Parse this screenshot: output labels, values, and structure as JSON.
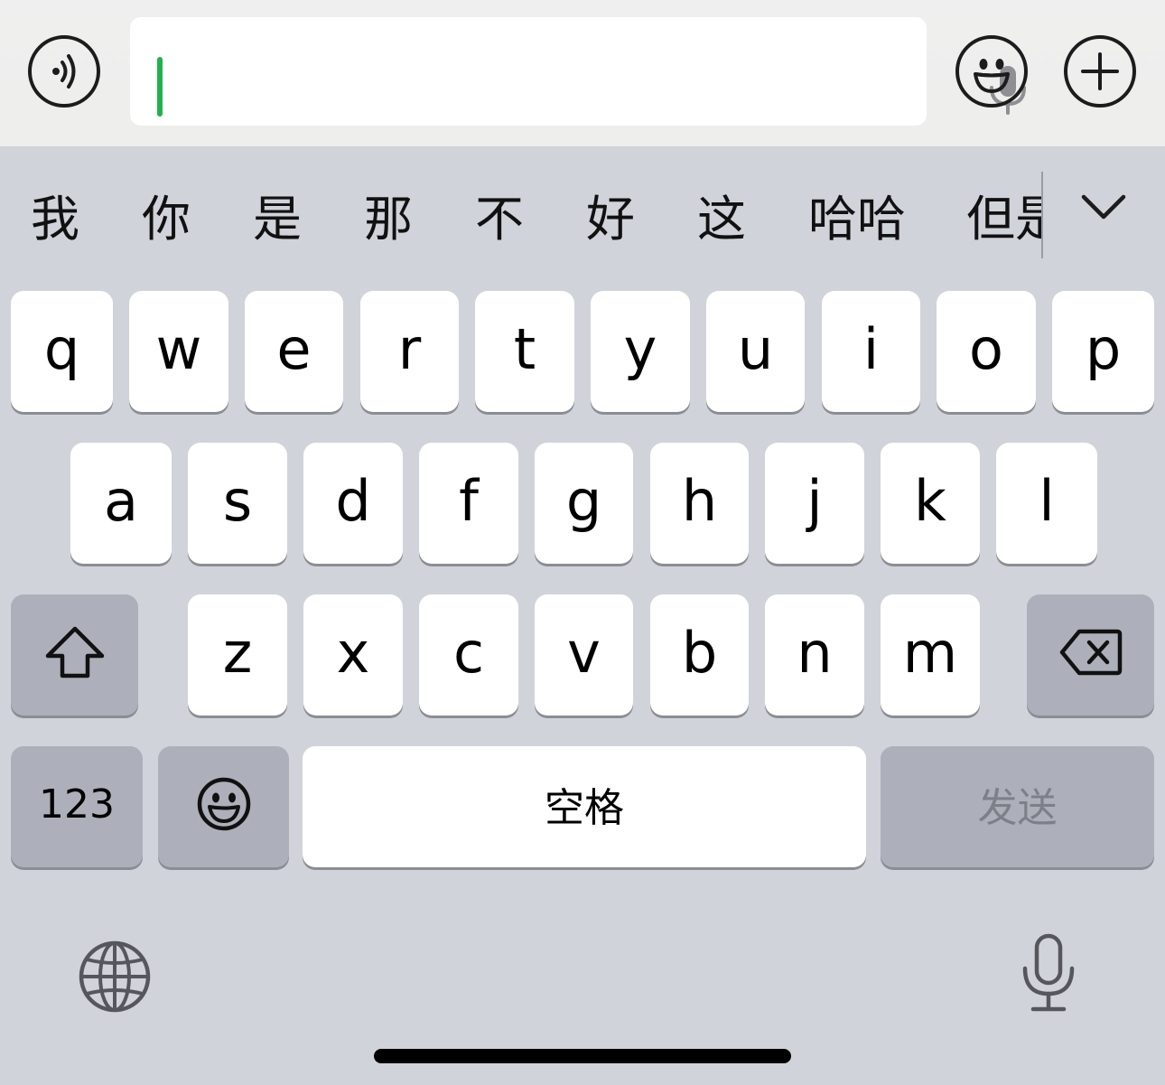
{
  "input_bar": {
    "voice_button_icon": "voice-wave-icon",
    "text_value": "",
    "input_mic_icon": "microphone-icon",
    "emoji_button_icon": "smiley-icon",
    "plus_button_icon": "plus-icon",
    "caret_color": "#21b24f"
  },
  "candidates": {
    "items": [
      "我",
      "你",
      "是",
      "那",
      "不",
      "好",
      "这",
      "哈哈",
      "但是"
    ],
    "expand_icon": "chevron-down-icon"
  },
  "keyboard": {
    "row1": [
      "q",
      "w",
      "e",
      "r",
      "t",
      "y",
      "u",
      "i",
      "o",
      "p"
    ],
    "row2": [
      "a",
      "s",
      "d",
      "f",
      "g",
      "h",
      "j",
      "k",
      "l"
    ],
    "row3": [
      "z",
      "x",
      "c",
      "v",
      "b",
      "n",
      "m"
    ],
    "shift_icon": "shift-arrow-icon",
    "delete_icon": "backspace-icon",
    "numbers_label": "123",
    "emoji_icon": "smiley-icon",
    "space_label": "空格",
    "send_label": "发送",
    "globe_icon": "globe-icon",
    "dictation_icon": "microphone-icon"
  },
  "colors": {
    "keyboard_background": "#d1d3da",
    "key_background": "#ffffff",
    "function_key_background": "#adb0ba",
    "send_label_color": "#7d8089"
  }
}
